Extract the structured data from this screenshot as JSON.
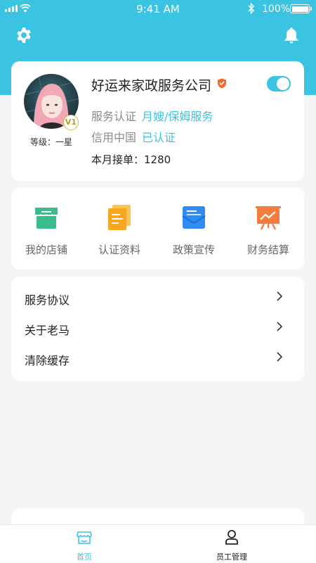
{
  "status_bar": {
    "time": "9:41 AM",
    "battery": "100%"
  },
  "colors": {
    "accent": "#3bc3e2",
    "verified_badge": "#f06a2d",
    "green": "#39bd8a",
    "orange": "#f9a51e",
    "blue": "#2f8cf0",
    "report_orange": "#f47c3c"
  },
  "header": {
    "icons": [
      "gear-icon",
      "bell-icon"
    ]
  },
  "profile": {
    "company_name": "好运来家政服务公司",
    "level": "等级：一星",
    "vip_badge": "V1",
    "service_cert_label": "服务认证",
    "service_cert_value": "月嫂/保姆服务",
    "credit_label": "信用中国",
    "credit_value": "已认证",
    "monthly_orders": "本月接单：1280",
    "toggle_on": true
  },
  "quick_actions": [
    {
      "label": "我的店铺",
      "icon": "store-icon"
    },
    {
      "label": "认证资料",
      "icon": "documents-icon"
    },
    {
      "label": "政策宣传",
      "icon": "mail-icon"
    },
    {
      "label": "财务结算",
      "icon": "chart-board-icon"
    }
  ],
  "menu": [
    {
      "label": "服务协议"
    },
    {
      "label": "关于老马"
    },
    {
      "label": "清除缓存"
    }
  ],
  "tabbar": [
    {
      "label": "首页",
      "icon": "home-store-icon",
      "active": true
    },
    {
      "label": "员工管理",
      "icon": "person-icon",
      "active": false
    }
  ]
}
